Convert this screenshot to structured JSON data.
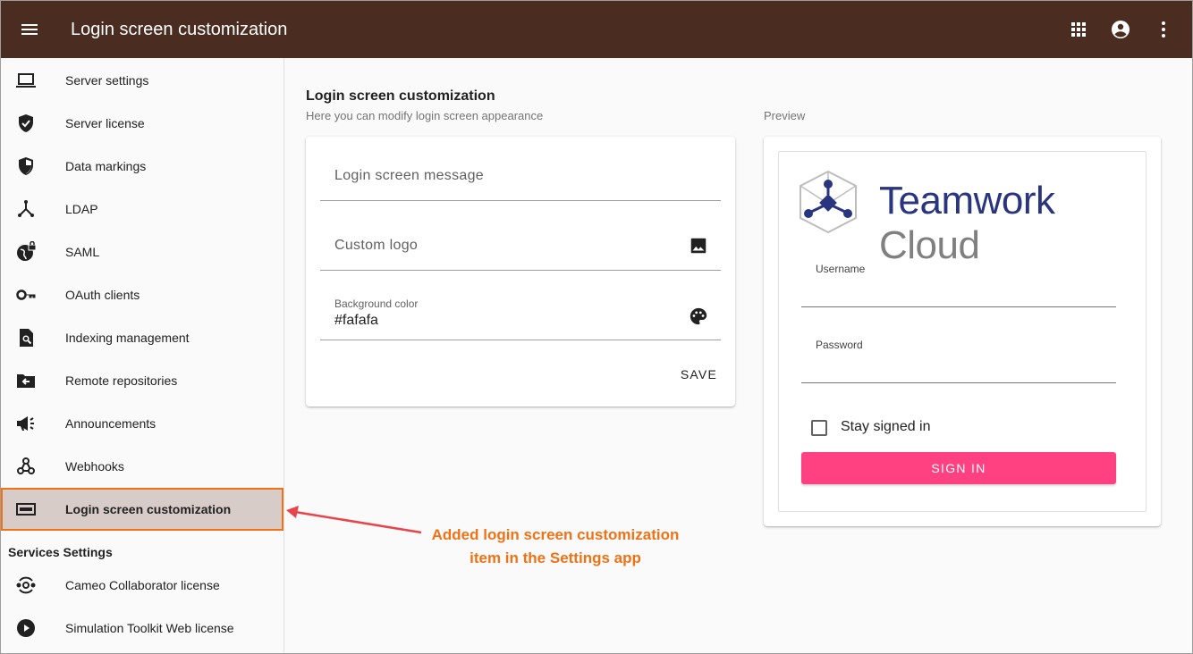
{
  "appbar": {
    "title": "Login screen customization",
    "icons": [
      "menu-icon",
      "apps-icon",
      "account-circle-icon",
      "more-vert-icon"
    ],
    "background": "#4a2c20"
  },
  "sidebar": {
    "items": [
      {
        "label": "Server settings",
        "icon": "laptop-icon"
      },
      {
        "label": "Server license",
        "icon": "verified-shield-icon"
      },
      {
        "label": "Data markings",
        "icon": "shield-icon"
      },
      {
        "label": "LDAP",
        "icon": "hub-icon"
      },
      {
        "label": "SAML",
        "icon": "globe-lock-icon"
      },
      {
        "label": "OAuth clients",
        "icon": "key-icon"
      },
      {
        "label": "Indexing management",
        "icon": "file-search-icon"
      },
      {
        "label": "Remote repositories",
        "icon": "folder-arrow-icon"
      },
      {
        "label": "Announcements",
        "icon": "megaphone-icon"
      },
      {
        "label": "Webhooks",
        "icon": "webhook-icon"
      },
      {
        "label": "Login screen customization",
        "icon": "screen-icon",
        "active": true
      }
    ],
    "services_header": "Services Settings",
    "services_items": [
      {
        "label": "Cameo Collaborator license",
        "icon": "orbit-icon"
      },
      {
        "label": "Simulation Toolkit Web license",
        "icon": "play-circle-icon"
      }
    ],
    "active_bg": "#d7ccc8",
    "highlight_color": "#f07215"
  },
  "main": {
    "title": "Login screen customization",
    "subtitle": "Here you can modify login screen appearance",
    "form": {
      "message_placeholder": "Login screen message",
      "logo_placeholder": "Custom logo",
      "bg_label": "Background color",
      "bg_value": "#fafafa",
      "save_label": "SAVE"
    }
  },
  "preview": {
    "label": "Preview",
    "brand_part1": "Teamwork",
    "brand_part2": "Cloud",
    "username_label": "Username",
    "password_label": "Password",
    "stay_signed_in": "Stay signed in",
    "signin_label": "SIGN IN",
    "signin_color": "#ff4081"
  },
  "annotation": {
    "line1": "Added login screen customization",
    "line2": "item in the Settings app"
  }
}
